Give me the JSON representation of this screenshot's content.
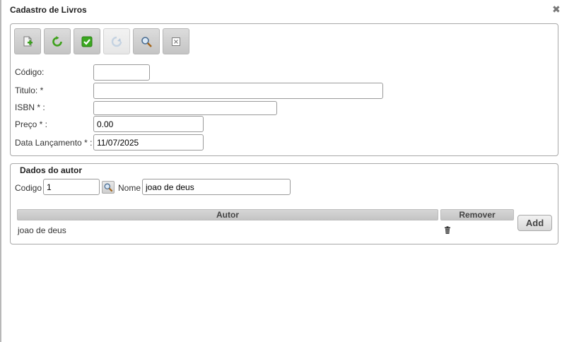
{
  "dialog": {
    "title": "Cadastro de Livros"
  },
  "toolbar": {
    "buttons": [
      {
        "name": "new-document-button",
        "icon": "new-document-icon",
        "enabled": true
      },
      {
        "name": "refresh-button",
        "icon": "refresh-icon",
        "enabled": true
      },
      {
        "name": "save-confirm-button",
        "icon": "check-icon",
        "enabled": true
      },
      {
        "name": "disabled-action-button",
        "icon": "cycle-icon",
        "enabled": false
      },
      {
        "name": "search-button",
        "icon": "magnifier-icon",
        "enabled": true
      },
      {
        "name": "cancel-button",
        "icon": "close-box-icon",
        "enabled": true
      }
    ]
  },
  "form": {
    "codigo": {
      "label": "Código:",
      "value": ""
    },
    "titulo": {
      "label": "Titulo: *",
      "value": ""
    },
    "isbn": {
      "label": "ISBN * :",
      "value": ""
    },
    "preco": {
      "label": "Preço * :",
      "value": "0.00"
    },
    "data_lancamento": {
      "label": "Data Lançamento * :",
      "value": "11/07/2025"
    }
  },
  "author_section": {
    "legend": "Dados do autor",
    "codigo_label": "Codigo",
    "codigo_value": "1",
    "nome_label": "Nome",
    "nome_value": "joao de deus",
    "table": {
      "columns": [
        "Autor",
        "Remover"
      ],
      "rows": [
        {
          "autor": "joao de deus",
          "remove_icon": "trash-icon"
        }
      ]
    },
    "add_label": "Add"
  }
}
